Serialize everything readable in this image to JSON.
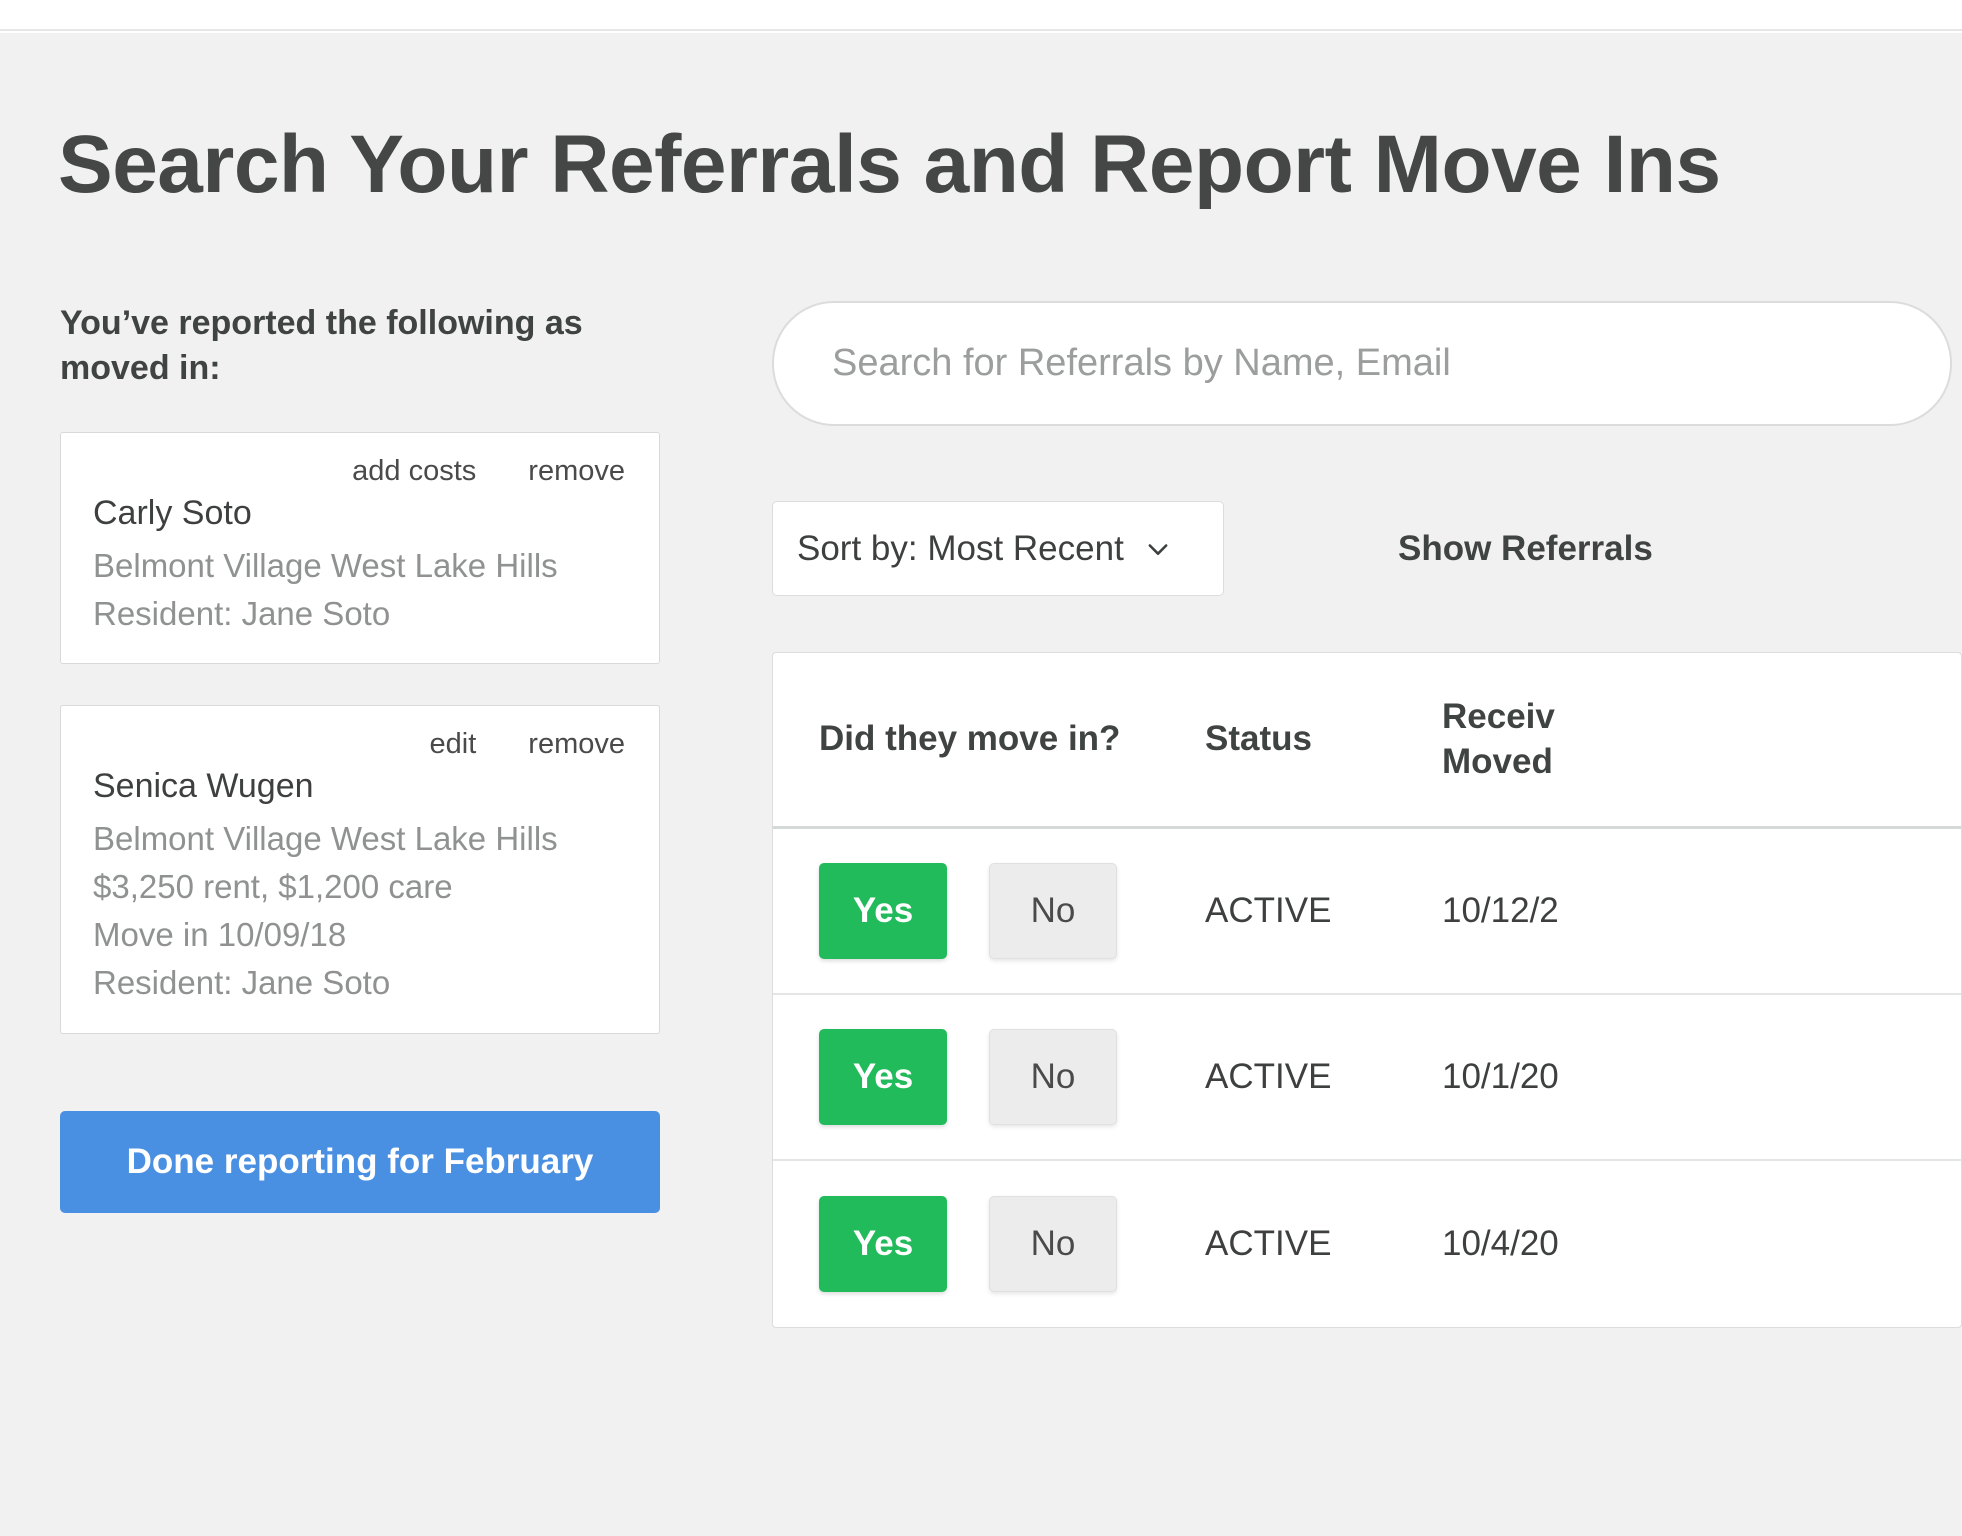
{
  "page": {
    "title": "Search Your Referrals and Report Move Ins",
    "background_color": "#f1f1f1"
  },
  "left_panel": {
    "heading": "You’ve reported the following as moved in:",
    "cards": [
      {
        "actions": [
          "add costs",
          "remove"
        ],
        "name": "Carly Soto",
        "lines": [
          "Belmont Village West Lake Hills",
          "Resident: Jane Soto"
        ]
      },
      {
        "actions": [
          "edit",
          "remove"
        ],
        "name": "Senica Wugen",
        "lines": [
          "Belmont Village West Lake Hills",
          "$3,250 rent, $1,200 care",
          "Move in 10/09/18",
          "Resident: Jane Soto"
        ]
      }
    ],
    "done_button": {
      "label": "Done reporting for February",
      "color": "#4a90e2"
    }
  },
  "right_panel": {
    "search": {
      "placeholder": "Search for Referrals by Name, Email",
      "value": ""
    },
    "sort": {
      "label": "Sort by: Most Recent",
      "icon": "chevron-down-icon"
    },
    "show_referrals_label": "Show Referrals",
    "table": {
      "columns": [
        "Did they move in?",
        "Status",
        "Received Moved"
      ],
      "column_recv_line1": "Receiv",
      "column_recv_line2": "Moved",
      "rows": [
        {
          "yes_label": "Yes",
          "no_label": "No",
          "selected": "Yes",
          "status": "ACTIVE",
          "received": "10/12/2"
        },
        {
          "yes_label": "Yes",
          "no_label": "No",
          "selected": "Yes",
          "status": "ACTIVE",
          "received": "10/1/20"
        },
        {
          "yes_label": "Yes",
          "no_label": "No",
          "selected": "Yes",
          "status": "ACTIVE",
          "received": "10/4/20"
        }
      ]
    },
    "colors": {
      "yes_green": "#22bb5b",
      "no_grey": "#ececec"
    }
  }
}
